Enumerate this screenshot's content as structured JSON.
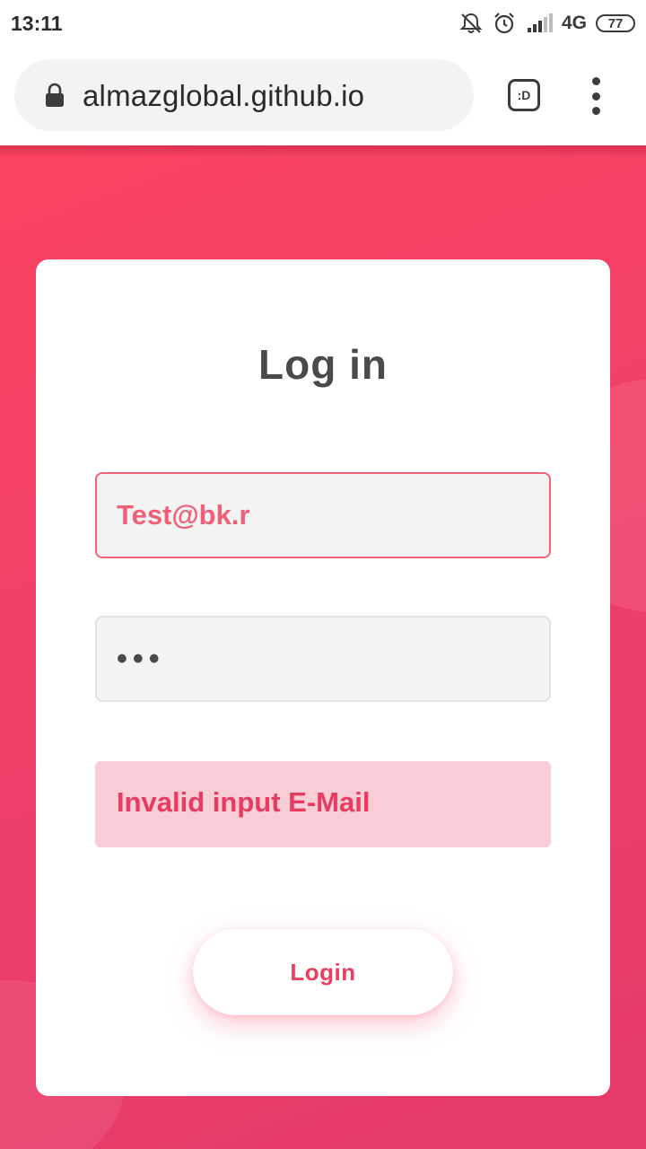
{
  "status_bar": {
    "time": "13:11",
    "network": "4G",
    "battery": "77",
    "icons": [
      "bell-off-icon",
      "alarm-icon",
      "signal-icon"
    ]
  },
  "browser": {
    "url": "almazglobal.github.io",
    "extension_label": ":D",
    "icons": [
      "lock-icon",
      "menu-dots-icon"
    ]
  },
  "login_form": {
    "title": "Log in",
    "email_value": "Test@bk.r",
    "password_masked": "•••",
    "error_message": "Invalid input E-Mail",
    "submit_label": "Login"
  },
  "colors": {
    "accent": "#f1406a",
    "error_text": "#e83b5f",
    "error_bg": "#f8cdd6"
  }
}
